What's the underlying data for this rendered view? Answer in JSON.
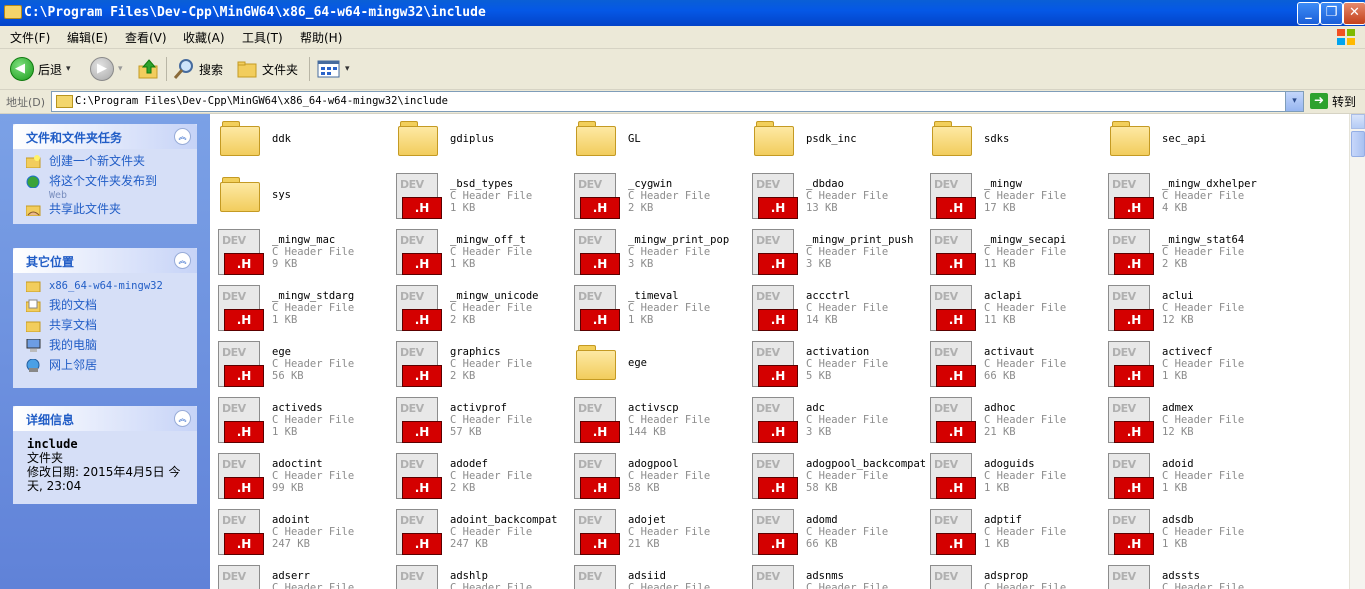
{
  "window": {
    "title": "C:\\Program Files\\Dev-Cpp\\MinGW64\\x86_64-w64-mingw32\\include",
    "btn_min": "_",
    "btn_max": "❐",
    "btn_close": "✕"
  },
  "menu": [
    "文件(F)",
    "编辑(E)",
    "查看(V)",
    "收藏(A)",
    "工具(T)",
    "帮助(H)"
  ],
  "toolbar": {
    "back": "后退",
    "search": "搜索",
    "folders": "文件夹",
    "dropdown_arrow": "▾"
  },
  "address": {
    "label": "地址(D)",
    "value": "C:\\Program Files\\Dev-Cpp\\MinGW64\\x86_64-w64-mingw32\\include",
    "go": "转到"
  },
  "left_pane": {
    "tasks": {
      "title": "文件和文件夹任务",
      "items": [
        {
          "label": "创建一个新文件夹",
          "icon": "new-folder-icon"
        },
        {
          "label": "将这个文件夹发布到",
          "sub": "Web",
          "icon": "publish-web-icon"
        },
        {
          "label": "共享此文件夹",
          "icon": "share-folder-icon"
        }
      ]
    },
    "places": {
      "title": "其它位置",
      "items": [
        {
          "label": "x86_64-w64-mingw32",
          "icon": "folder-icon"
        },
        {
          "label": "我的文档",
          "icon": "my-documents-icon"
        },
        {
          "label": "共享文档",
          "icon": "shared-documents-icon"
        },
        {
          "label": "我的电脑",
          "icon": "my-computer-icon"
        },
        {
          "label": "网上邻居",
          "icon": "network-places-icon"
        }
      ]
    },
    "details": {
      "title": "详细信息",
      "name": "include",
      "type": "文件夹",
      "modified": "修改日期: 2015年4月5日 今天, 23:04"
    }
  },
  "files": [
    {
      "name": "ddk",
      "kind": "folder"
    },
    {
      "name": "gdiplus",
      "kind": "folder"
    },
    {
      "name": "GL",
      "kind": "folder"
    },
    {
      "name": "psdk_inc",
      "kind": "folder"
    },
    {
      "name": "sdks",
      "kind": "folder"
    },
    {
      "name": "sec_api",
      "kind": "folder"
    },
    {
      "name": "sys",
      "kind": "folder"
    },
    {
      "name": "_bsd_types",
      "kind": "header",
      "type": "C Header File",
      "size": "1 KB"
    },
    {
      "name": "_cygwin",
      "kind": "header",
      "type": "C Header File",
      "size": "2 KB"
    },
    {
      "name": "_dbdao",
      "kind": "header",
      "type": "C Header File",
      "size": "13 KB"
    },
    {
      "name": "_mingw",
      "kind": "header",
      "type": "C Header File",
      "size": "17 KB"
    },
    {
      "name": "_mingw_dxhelper",
      "kind": "header",
      "type": "C Header File",
      "size": "4 KB"
    },
    {
      "name": "_mingw_mac",
      "kind": "header",
      "type": "C Header File",
      "size": "9 KB"
    },
    {
      "name": "_mingw_off_t",
      "kind": "header",
      "type": "C Header File",
      "size": "1 KB"
    },
    {
      "name": "_mingw_print_pop",
      "kind": "header",
      "type": "C Header File",
      "size": "3 KB"
    },
    {
      "name": "_mingw_print_push",
      "kind": "header",
      "type": "C Header File",
      "size": "3 KB"
    },
    {
      "name": "_mingw_secapi",
      "kind": "header",
      "type": "C Header File",
      "size": "11 KB"
    },
    {
      "name": "_mingw_stat64",
      "kind": "header",
      "type": "C Header File",
      "size": "2 KB"
    },
    {
      "name": "_mingw_stdarg",
      "kind": "header",
      "type": "C Header File",
      "size": "1 KB"
    },
    {
      "name": "_mingw_unicode",
      "kind": "header",
      "type": "C Header File",
      "size": "2 KB"
    },
    {
      "name": "_timeval",
      "kind": "header",
      "type": "C Header File",
      "size": "1 KB"
    },
    {
      "name": "accctrl",
      "kind": "header",
      "type": "C Header File",
      "size": "14 KB"
    },
    {
      "name": "aclapi",
      "kind": "header",
      "type": "C Header File",
      "size": "11 KB"
    },
    {
      "name": "aclui",
      "kind": "header",
      "type": "C Header File",
      "size": "12 KB"
    },
    {
      "name": "ege",
      "kind": "header",
      "type": "C Header File",
      "size": "56 KB"
    },
    {
      "name": "graphics",
      "kind": "header",
      "type": "C Header File",
      "size": "2 KB"
    },
    {
      "name": "ege",
      "kind": "folder"
    },
    {
      "name": "activation",
      "kind": "header",
      "type": "C Header File",
      "size": "5 KB"
    },
    {
      "name": "activaut",
      "kind": "header",
      "type": "C Header File",
      "size": "66 KB"
    },
    {
      "name": "activecf",
      "kind": "header",
      "type": "C Header File",
      "size": "1 KB"
    },
    {
      "name": "activeds",
      "kind": "header",
      "type": "C Header File",
      "size": "1 KB"
    },
    {
      "name": "activprof",
      "kind": "header",
      "type": "C Header File",
      "size": "57 KB"
    },
    {
      "name": "activscp",
      "kind": "header",
      "type": "C Header File",
      "size": "144 KB"
    },
    {
      "name": "adc",
      "kind": "header",
      "type": "C Header File",
      "size": "3 KB"
    },
    {
      "name": "adhoc",
      "kind": "header",
      "type": "C Header File",
      "size": "21 KB"
    },
    {
      "name": "admex",
      "kind": "header",
      "type": "C Header File",
      "size": "12 KB"
    },
    {
      "name": "adoctint",
      "kind": "header",
      "type": "C Header File",
      "size": "99 KB"
    },
    {
      "name": "adodef",
      "kind": "header",
      "type": "C Header File",
      "size": "2 KB"
    },
    {
      "name": "adogpool",
      "kind": "header",
      "type": "C Header File",
      "size": "58 KB"
    },
    {
      "name": "adogpool_backcompat",
      "kind": "header",
      "type": "C Header File",
      "size": "58 KB"
    },
    {
      "name": "adoguids",
      "kind": "header",
      "type": "C Header File",
      "size": "1 KB"
    },
    {
      "name": "adoid",
      "kind": "header",
      "type": "C Header File",
      "size": "1 KB"
    },
    {
      "name": "adoint",
      "kind": "header",
      "type": "C Header File",
      "size": "247 KB"
    },
    {
      "name": "adoint_backcompat",
      "kind": "header",
      "type": "C Header File",
      "size": "247 KB"
    },
    {
      "name": "adojet",
      "kind": "header",
      "type": "C Header File",
      "size": "21 KB"
    },
    {
      "name": "adomd",
      "kind": "header",
      "type": "C Header File",
      "size": "66 KB"
    },
    {
      "name": "adptif",
      "kind": "header",
      "type": "C Header File",
      "size": "1 KB"
    },
    {
      "name": "adsdb",
      "kind": "header",
      "type": "C Header File",
      "size": "1 KB"
    },
    {
      "name": "adserr",
      "kind": "header",
      "type": "C Header File",
      "size": ""
    },
    {
      "name": "adshlp",
      "kind": "header",
      "type": "C Header File",
      "size": ""
    },
    {
      "name": "adsiid",
      "kind": "header",
      "type": "C Header File",
      "size": ""
    },
    {
      "name": "adsnms",
      "kind": "header",
      "type": "C Header File",
      "size": ""
    },
    {
      "name": "adsprop",
      "kind": "header",
      "type": "C Header File",
      "size": ""
    },
    {
      "name": "adssts",
      "kind": "header",
      "type": "C Header File",
      "size": ""
    }
  ],
  "icons": {
    "dev_label": "DEV",
    "h_label": ".H"
  },
  "colors": {
    "titlebar": "#0558e6",
    "task_link": "#215dc6",
    "header_red": "#d40000",
    "folder_yellow": "#f2cd5d"
  }
}
